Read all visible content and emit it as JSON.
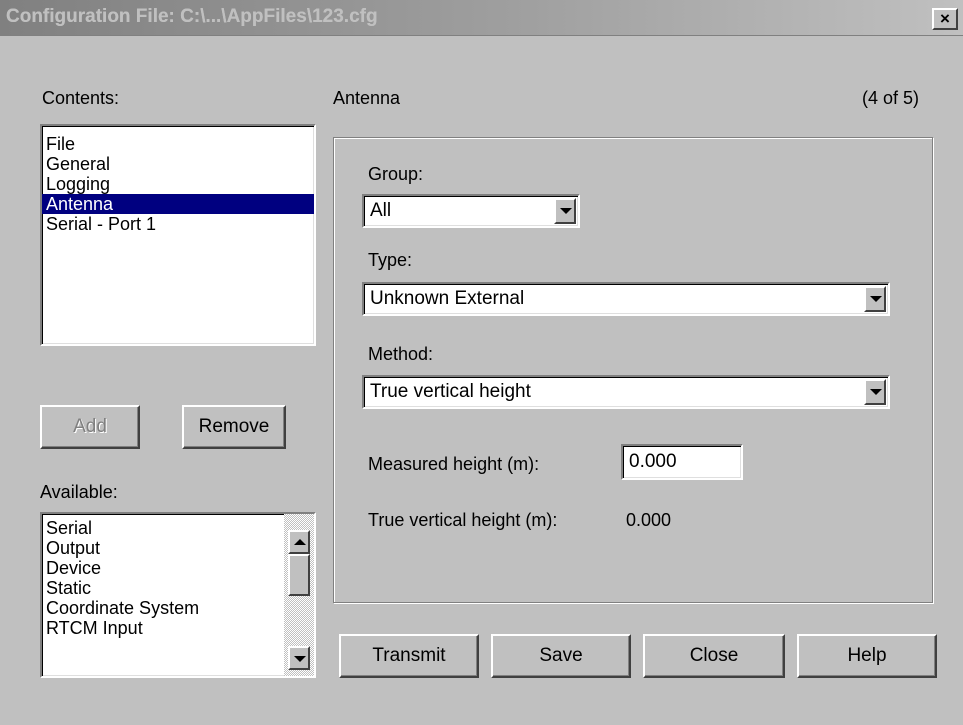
{
  "window": {
    "title": "Configuration File: C:\\...\\AppFiles\\123.cfg",
    "close_label": "×"
  },
  "contents": {
    "label": "Contents:",
    "items": [
      "File",
      "General",
      "Logging",
      "Antenna",
      "Serial - Port 1"
    ],
    "selected": "Antenna"
  },
  "buttons": {
    "add": "Add",
    "remove": "Remove",
    "transmit": "Transmit",
    "save": "Save",
    "close": "Close",
    "help": "Help"
  },
  "available": {
    "label": "Available:",
    "items": [
      "Serial",
      "Output",
      "Device",
      "Static",
      "Coordinate System",
      "RTCM Input"
    ]
  },
  "panel": {
    "title": "Antenna",
    "position": "(4 of 5)",
    "group_label": "Group:",
    "group_value": "All",
    "type_label": "Type:",
    "type_value": "Unknown External",
    "method_label": "Method:",
    "method_value": "True vertical height",
    "measured_label": "Measured height (m):",
    "measured_value": "0.000",
    "true_label": "True vertical height (m):",
    "true_value": "0.000"
  },
  "colors": {
    "selection": "#000080",
    "face": "#c0c0c0"
  }
}
